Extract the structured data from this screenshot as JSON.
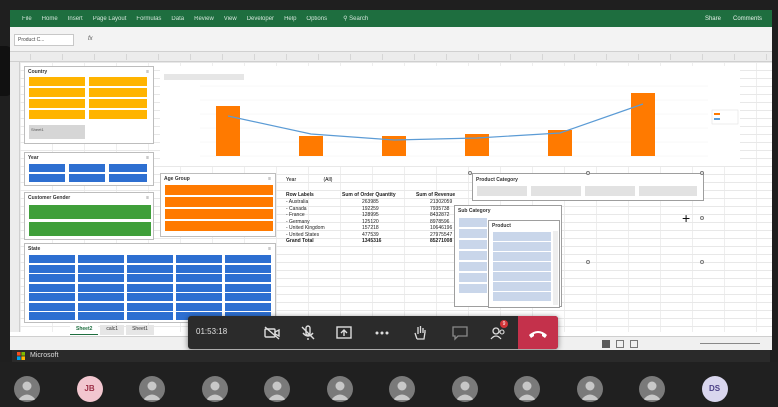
{
  "ribbon": {
    "tabs": [
      "File",
      "Home",
      "Insert",
      "Page Layout",
      "Formulas",
      "Data",
      "Review",
      "View",
      "Developer",
      "Help",
      "Options"
    ],
    "search": "Search",
    "share": "Share",
    "comments": "Comments"
  },
  "formula_bar": {
    "name_box": "Product C...",
    "fx": "fx"
  },
  "slicers": {
    "country": "Country",
    "year": "Year",
    "customer_gender": "Customer Gender",
    "age_group": "Age Group",
    "state": "State",
    "product_category": "Product Category",
    "sub_category": "Sub Category",
    "product": "Product",
    "country_items": [
      "Sheet1"
    ]
  },
  "pivot": {
    "filter_label": "Year",
    "filter_value": "(All)",
    "headers": [
      "Row Labels",
      "Sum of Order Quantity",
      "Sum of Revenue"
    ],
    "rows": [
      {
        "label": "- Australia",
        "qty": "263985",
        "rev": "21302059"
      },
      {
        "label": "- Canada",
        "qty": "192259",
        "rev": "7935738"
      },
      {
        "label": "- France",
        "qty": "128995",
        "rev": "8432872"
      },
      {
        "label": "- Germany",
        "qty": "125120",
        "rev": "8978596"
      },
      {
        "label": "- United Kingdom",
        "qty": "157218",
        "rev": "10646196"
      },
      {
        "label": "- United States",
        "qty": "477539",
        "rev": "27975547"
      },
      {
        "label": "Grand Total",
        "qty": "1345316",
        "rev": "85271008"
      }
    ]
  },
  "sheet_tabs": [
    "Sheet2",
    "calc1",
    "Sheet1"
  ],
  "call": {
    "timer": "01:53:18",
    "badge": "9"
  },
  "taskbar": {
    "label": "Microsoft"
  },
  "participants": [
    {
      "type": "photo"
    },
    {
      "type": "initials",
      "initials": "JB"
    },
    {
      "type": "photo"
    },
    {
      "type": "photo"
    },
    {
      "type": "photo"
    },
    {
      "type": "photo"
    },
    {
      "type": "photo"
    },
    {
      "type": "photo"
    },
    {
      "type": "photo"
    },
    {
      "type": "photo"
    },
    {
      "type": "photo"
    },
    {
      "type": "initials",
      "initials": "DS"
    }
  ],
  "colors": {
    "ribbon": "#1e6e3f",
    "slicer_orange": "#ff7a00",
    "slicer_yellow": "#ffb400",
    "slicer_blue": "#2d6fd1",
    "slicer_green": "#3f9f3a",
    "hangup": "#c4314b"
  }
}
